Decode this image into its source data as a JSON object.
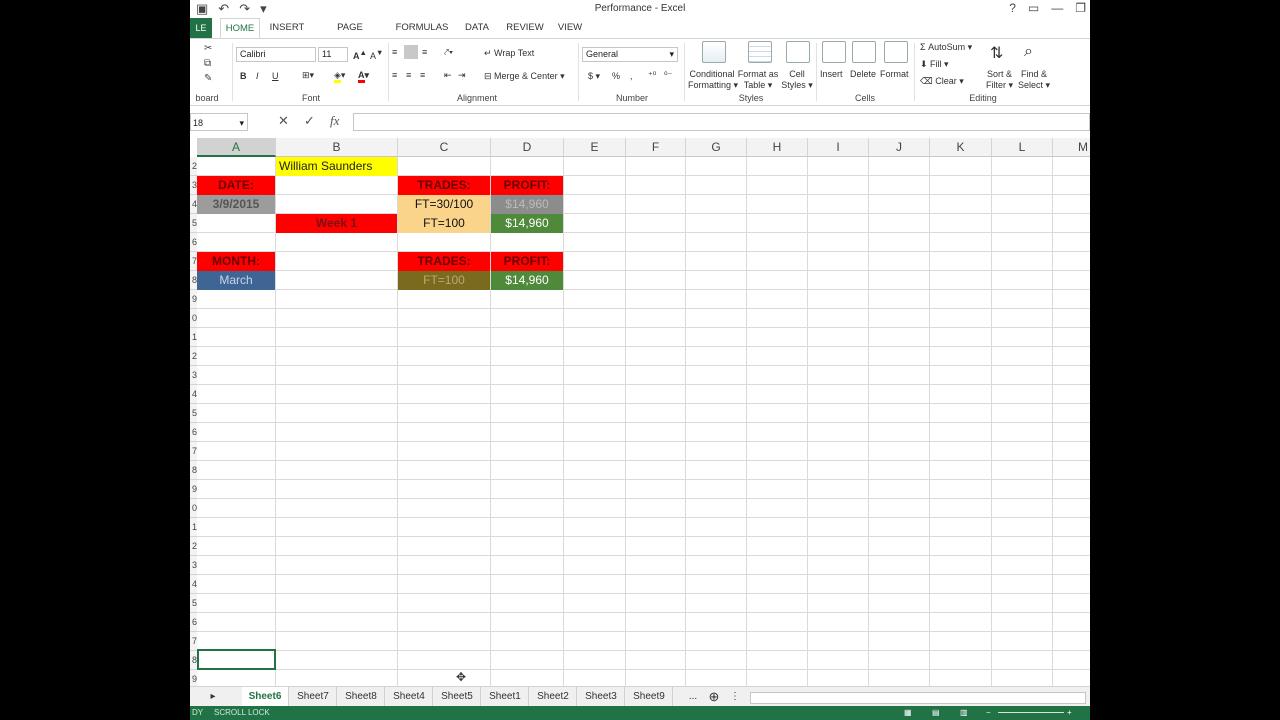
{
  "window": {
    "title": "Performance - Excel",
    "help": "?"
  },
  "tabs": {
    "file": "LE",
    "items": [
      "HOME",
      "INSERT",
      "PAGE LAYOUT",
      "FORMULAS",
      "DATA",
      "REVIEW",
      "VIEW"
    ]
  },
  "ribbon": {
    "font_name": "Calibri",
    "font_size": "11",
    "wrap_text": "Wrap Text",
    "merge_center": "Merge & Center",
    "number_format": "General",
    "conditional_formatting": [
      "Conditional",
      "Formatting"
    ],
    "format_as_table": [
      "Format as",
      "Table"
    ],
    "cell_styles": [
      "Cell",
      "Styles"
    ],
    "insert": "Insert",
    "delete": "Delete",
    "format": "Format",
    "autosum": "AutoSum",
    "fill": "Fill",
    "clear": "Clear",
    "sort_filter": [
      "Sort &",
      "Filter"
    ],
    "find_select": [
      "Find &",
      "Select"
    ],
    "groups": {
      "clipboard": "board",
      "font": "Font",
      "alignment": "Alignment",
      "number": "Number",
      "styles": "Styles",
      "cells": "Cells",
      "editing": "Editing"
    },
    "bold": "B",
    "italic": "I",
    "underline": "U",
    "currency": "$",
    "percent": "%",
    "comma": ","
  },
  "formula_bar": {
    "name_box": "18",
    "cancel": "✕",
    "enter": "✓",
    "fx": "fx",
    "value": ""
  },
  "grid": {
    "columns": [
      "A",
      "B",
      "C",
      "D",
      "E",
      "F",
      "G",
      "H",
      "I",
      "J",
      "K",
      "L",
      "M"
    ],
    "row_numbers": [
      "2",
      "3",
      "4",
      "5",
      "6",
      "7",
      "8",
      "9",
      "0",
      "1",
      "2",
      "3",
      "4",
      "5",
      "6",
      "7",
      "8",
      "9",
      "0",
      "1",
      "2",
      "3",
      "4",
      "5",
      "6",
      "7",
      "8",
      "9"
    ],
    "cells": {
      "B2": "William Saunders",
      "A3": "DATE:",
      "C3": "TRADES:",
      "D3": "PROFIT:",
      "A4": "3/9/2015",
      "C4": "FT=30/100",
      "D4": "$14,960",
      "B5": "Week 1",
      "C5": "FT=100",
      "D5": "$14,960",
      "A7": "MONTH:",
      "C7": "TRADES:",
      "D7": "PROFIT:",
      "A8": "March",
      "C8": "FT=100",
      "D8": "$14,960"
    }
  },
  "sheets": {
    "active": "Sheet6",
    "items": [
      "Sheet6",
      "Sheet7",
      "Sheet8",
      "Sheet4",
      "Sheet5",
      "Sheet1",
      "Sheet2",
      "Sheet3",
      "Sheet9"
    ],
    "more": "...",
    "add": "⊕"
  },
  "status": {
    "left": "DY",
    "scroll_lock": "SCROLL LOCK"
  },
  "colors": {
    "excel_green": "#217346",
    "red": "#ff0000",
    "yellow": "#ffff00",
    "tan": "#f9d48a",
    "olive": "#7a6a1e",
    "green": "#4e8a3a",
    "blue": "#3e6594",
    "gray": "#9c9c9c"
  }
}
